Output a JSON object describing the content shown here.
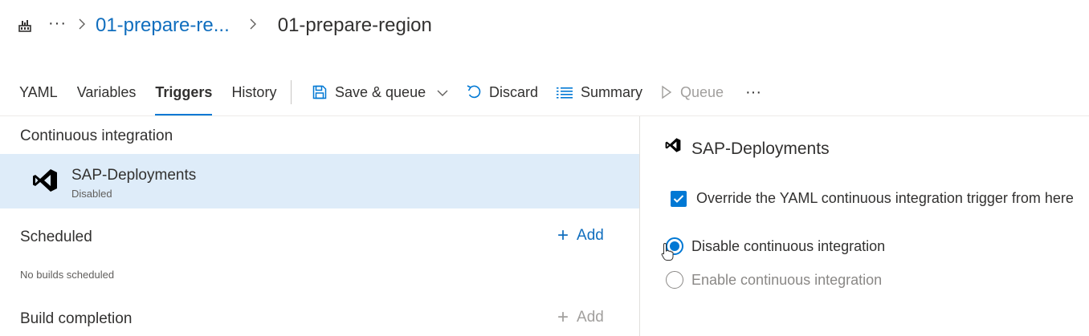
{
  "breadcrumb": {
    "pipeline_icon": "pipeline-icon",
    "more_icon": "ellipsis-icon",
    "more_label": "···",
    "separator": ">",
    "parent": "01-prepare-re...",
    "current": "01-prepare-region"
  },
  "tabs": [
    {
      "label": "YAML"
    },
    {
      "label": "Variables"
    },
    {
      "label": "Triggers",
      "active": true
    },
    {
      "label": "History"
    }
  ],
  "toolbar": {
    "save_queue": "Save & queue",
    "discard": "Discard",
    "summary": "Summary",
    "queue": "Queue",
    "more": "···"
  },
  "left": {
    "ci_heading": "Continuous integration",
    "ci_item": {
      "name": "SAP-Deployments",
      "status": "Disabled",
      "icon": "visual-studio-icon"
    },
    "scheduled_heading": "Scheduled",
    "scheduled_add": "Add",
    "no_builds": "No builds scheduled",
    "build_completion_heading": "Build completion",
    "build_completion_add": "Add"
  },
  "right": {
    "title": "SAP-Deployments",
    "override_label": "Override the YAML continuous integration trigger from here",
    "override_checked": true,
    "options": [
      {
        "label": "Disable continuous integration",
        "selected": true
      },
      {
        "label": "Enable continuous integration",
        "selected": false
      }
    ]
  },
  "colors": {
    "accent": "#0078d4",
    "link": "#106ebe",
    "selection": "#deecf9"
  }
}
